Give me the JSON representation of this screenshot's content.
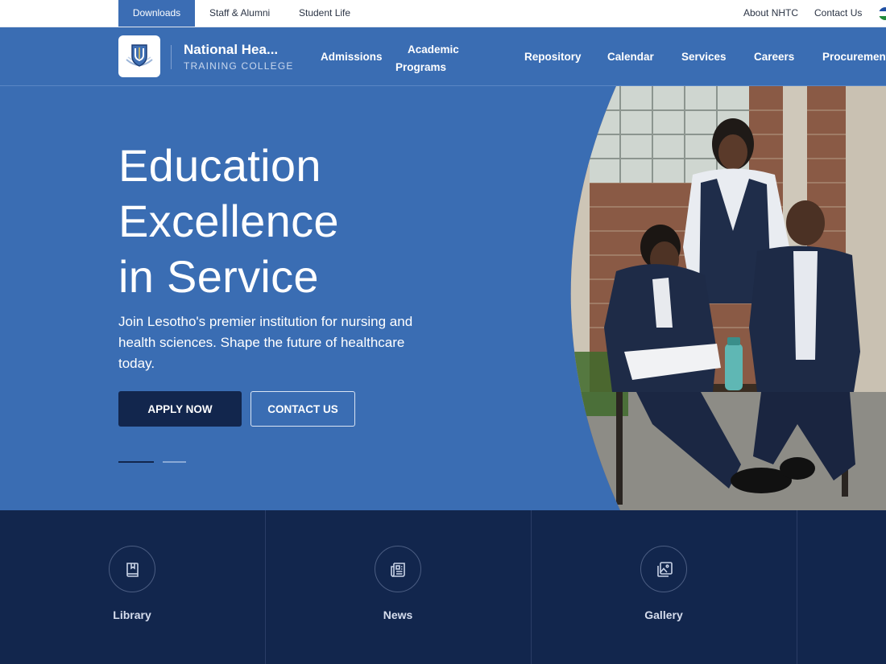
{
  "topbar": {
    "downloads": "Downloads",
    "staff_alumni": "Staff & Alumni",
    "student_life": "Student Life",
    "about": "About NHTC",
    "contact": "Contact Us"
  },
  "brand": {
    "name": "National Hea...",
    "subtitle": "TRAINING COLLEGE"
  },
  "nav": {
    "admissions": "Admissions",
    "academic_line1": "Academic",
    "academic_line2": "Programs",
    "repository": "Repository",
    "calendar": "Calendar",
    "services": "Services",
    "careers": "Careers",
    "procurement": "Procurement"
  },
  "hero": {
    "title_line1": "Education",
    "title_line2": "Excellence",
    "title_line3": "in Service",
    "description": "Join Lesotho's premier institution for nursing and health sciences. Shape the future of healthcare today.",
    "apply_label": "APPLY NOW",
    "contact_label": "CONTACT US",
    "active_slide": 1,
    "total_slides": 2
  },
  "quick_links": [
    {
      "label": "Library",
      "icon": "book-icon"
    },
    {
      "label": "News",
      "icon": "newspaper-icon"
    },
    {
      "label": "Gallery",
      "icon": "image-gallery-icon"
    }
  ],
  "colors": {
    "primary": "#3a6db3",
    "navy": "#12264d",
    "flag_blue": "#1f4fa3",
    "flag_white": "#ffffff",
    "flag_green": "#1f8a3a"
  }
}
